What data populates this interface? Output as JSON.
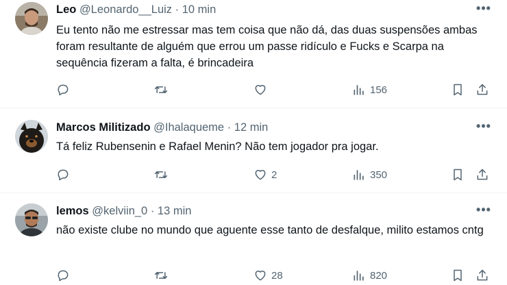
{
  "tweets": [
    {
      "display_name": "Leo",
      "handle": "@Leonardo__Luiz",
      "separator": "·",
      "time": "10 min",
      "text": "Eu tento não me estressar mas tem coisa que não dá, das duas suspensões ambas foram resultante de alguém que errou um passe ridículo e Fucks e Scarpa na sequência fizeram a falta, é brincadeira",
      "likes": "",
      "views": "156"
    },
    {
      "display_name": "Marcos Militizado",
      "handle": "@Ihalaqueme",
      "separator": "·",
      "time": "12 min",
      "text": "Tá feliz Rubensenin e Rafael Menin?  Não tem jogador pra jogar.",
      "likes": "2",
      "views": "350"
    },
    {
      "display_name": "lemos",
      "handle": "@kelviin_0",
      "separator": "·",
      "time": "13 min",
      "text": "não existe clube no mundo que aguente esse tanto de desfalque, milito estamos cntg",
      "likes": "28",
      "views": "820"
    }
  ],
  "icons": {
    "more": "more-icon",
    "reply": "reply-icon",
    "retweet": "retweet-icon",
    "like": "heart-icon",
    "views": "views-icon",
    "bookmark": "bookmark-icon",
    "share": "share-icon"
  },
  "colors": {
    "text": "#0f1419",
    "secondary": "#536471",
    "divider": "#eff3f4"
  }
}
